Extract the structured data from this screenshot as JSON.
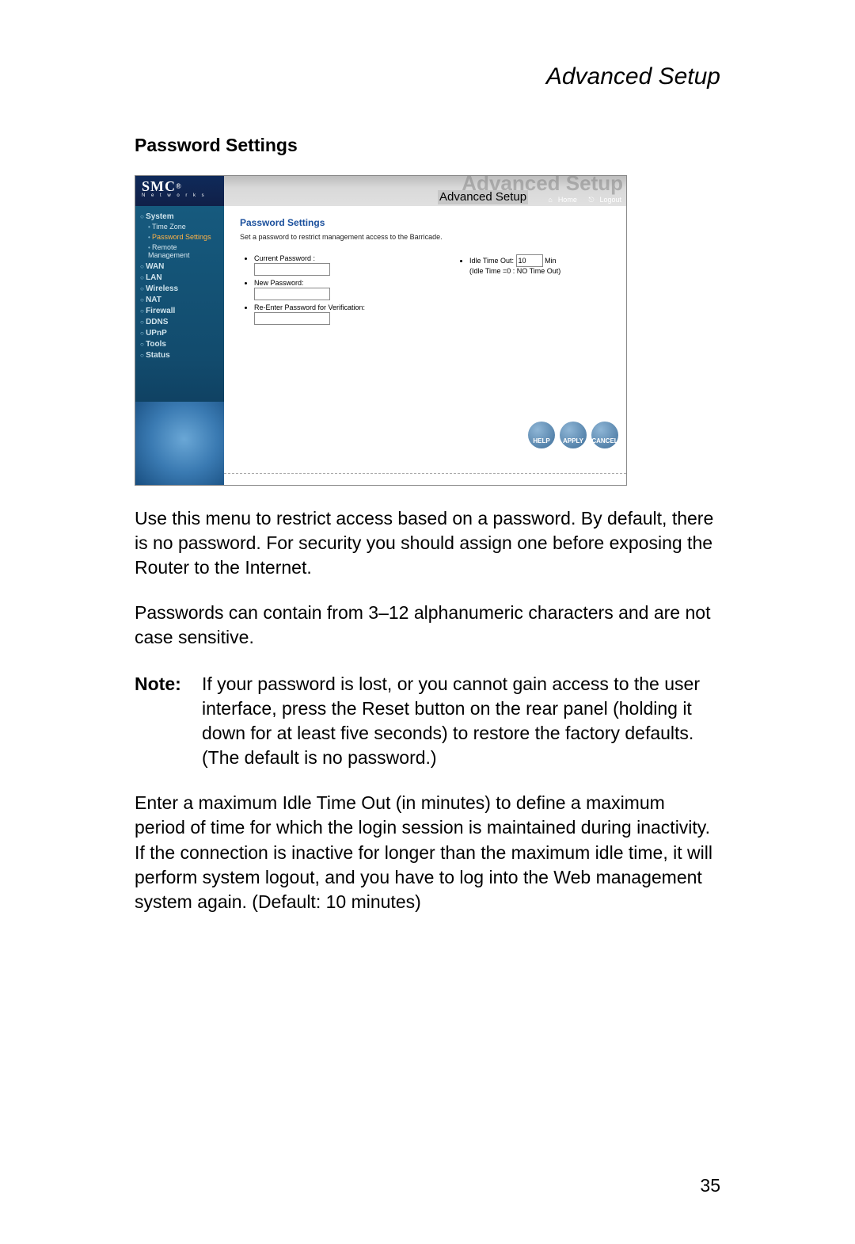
{
  "page_header": "Advanced Setup",
  "section_title": "Password Settings",
  "page_number": "35",
  "router": {
    "brand": "SMC",
    "brand_sub": "N e t w o r k s",
    "ghost": "Advanced Setup",
    "banner_label": "Advanced Setup",
    "home_link": "Home",
    "logout_link": "Logout",
    "sidebar": [
      {
        "type": "cat",
        "label": "System"
      },
      {
        "type": "item",
        "label": "Time Zone"
      },
      {
        "type": "item",
        "label": "Password Settings",
        "active": true
      },
      {
        "type": "item",
        "label": "Remote Management"
      },
      {
        "type": "cat",
        "label": "WAN"
      },
      {
        "type": "cat",
        "label": "LAN"
      },
      {
        "type": "cat",
        "label": "Wireless"
      },
      {
        "type": "cat",
        "label": "NAT"
      },
      {
        "type": "cat",
        "label": "Firewall"
      },
      {
        "type": "cat",
        "label": "DDNS"
      },
      {
        "type": "cat",
        "label": "UPnP"
      },
      {
        "type": "cat",
        "label": "Tools"
      },
      {
        "type": "cat",
        "label": "Status"
      }
    ],
    "main": {
      "title": "Password Settings",
      "desc": "Set a password to restrict management access to the Barricade.",
      "current_pw_label": "Current Password :",
      "new_pw_label": "New Password:",
      "reenter_label": "Re-Enter Password for Verification:",
      "idle_label_pre": "Idle Time Out:",
      "idle_value": "10",
      "idle_label_post": "Min",
      "idle_hint": "(Idle Time =0 : NO Time Out)",
      "btn_help": "HELP",
      "btn_apply": "APPLY",
      "btn_cancel": "CANCEL"
    }
  },
  "doc": {
    "p1": "Use this menu to restrict access based on a password. By default, there is no password. For security you should assign one before exposing the Router to the Internet.",
    "p2": "Passwords can contain from 3–12 alphanumeric characters and are not case sensitive.",
    "note_label": "Note:",
    "note_body": "If your password is lost, or you cannot gain access to the user interface, press the Reset button on the rear panel (holding it down for at least five seconds) to restore the factory defaults. (The default is no password.)",
    "p3": "Enter a maximum Idle Time Out (in minutes) to define a maximum period of time for which the login session is maintained during inactivity. If the connection is inactive for longer than the maximum idle time, it will perform system logout, and you have to log into the Web management system again. (Default: 10 minutes)"
  }
}
